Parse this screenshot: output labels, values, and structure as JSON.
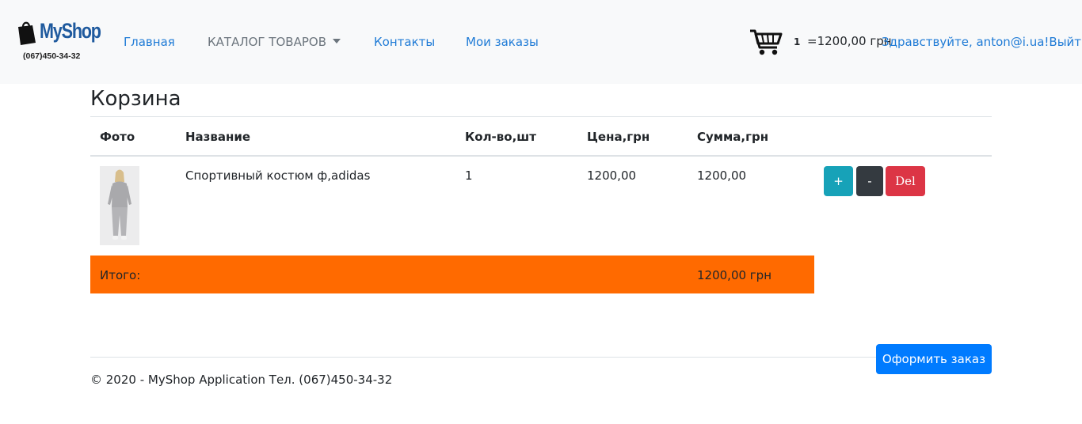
{
  "brand": {
    "name": "MyShop",
    "phone": "(067)450-34-32"
  },
  "nav": {
    "home": "Главная",
    "catalog": "КАТАЛОГ ТОВАРОВ",
    "contacts": "Контакты",
    "orders": "Мои заказы"
  },
  "cart": {
    "count": "1",
    "total": "=1200,00 грн"
  },
  "user": {
    "greeting": "Здравствуйте, anton@i.ua!",
    "logout": "Выйти"
  },
  "page": {
    "title": "Корзина"
  },
  "table": {
    "headers": [
      "Фото",
      "Название",
      "Кол-во,шт",
      "Цена,грн",
      "Сумма,грн"
    ],
    "rows": [
      {
        "name": "Спортивный костюм ф,adidas",
        "qty": "1",
        "price": "1200,00",
        "sum": "1200,00"
      }
    ],
    "buttons": {
      "plus": "+",
      "minus": "-",
      "del": "Del"
    },
    "total_label": "Итого:",
    "total_value": "1200,00 грн"
  },
  "order_button": "Оформить заказ",
  "footer": "© 2020 - MyShop Application Тел. (067)450-34-32",
  "colors": {
    "accent": "#007bff",
    "total_row": "#ff6a00",
    "info": "#17a2b8",
    "dark": "#343a40",
    "danger": "#dc3545",
    "navbar": "#f8f9fa"
  }
}
